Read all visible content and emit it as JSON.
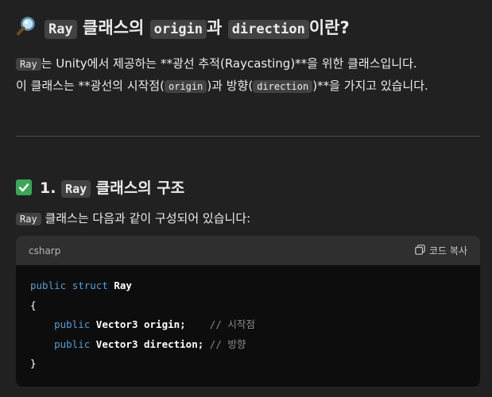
{
  "heading": {
    "emoji": "magnifier-icon",
    "code1": "Ray",
    "text1": " 클래스의 ",
    "code2": "origin",
    "text2": "과 ",
    "code3": "direction",
    "text3": "이란?"
  },
  "intro": {
    "line1_code": "Ray",
    "line1_text": "는 Unity에서 제공하는 **광선 추적(Raycasting)**을 위한 클래스입니다.",
    "line2_text1": "이 클래스는 **광선의 시작점(",
    "line2_code1": "origin",
    "line2_text2": ")과 방향(",
    "line2_code2": "direction",
    "line2_text3": ")**을 가지고 있습니다."
  },
  "section": {
    "icon": "check-icon",
    "number": "1. ",
    "code": "Ray",
    "title": " 클래스의 구조",
    "desc_code": "Ray",
    "desc_text": " 클래스는 다음과 같이 구성되어 있습니다:"
  },
  "codeblock": {
    "language": "csharp",
    "copy_label": "코드 복사",
    "lines": {
      "l1_kw1": "public",
      "l1_kw2": "struct",
      "l1_type": "Ray",
      "l2": "{",
      "l3_kw": "public",
      "l3_code": "Vector3 origin;",
      "l3_pad": "    ",
      "l3_comment": "// 시작점",
      "l4_kw": "public",
      "l4_code": "Vector3 direction;",
      "l4_pad": " ",
      "l4_comment": "// 방향",
      "l5": "}"
    }
  }
}
